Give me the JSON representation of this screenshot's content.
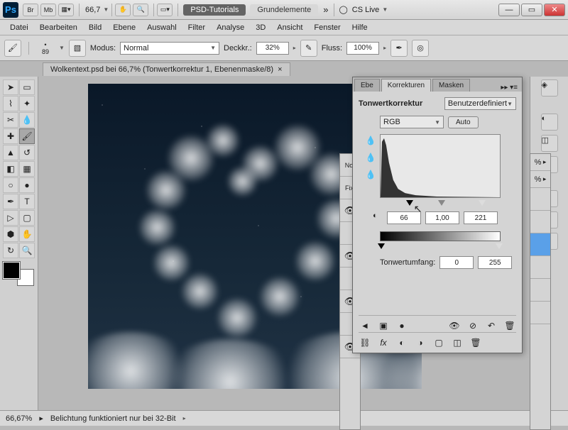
{
  "titlebar": {
    "zoom": "66,7",
    "tabs": [
      "PSD-Tutorials",
      "Grundelemente"
    ],
    "cslive": "CS Live"
  },
  "appicons": {
    "br": "Br",
    "mb": "Mb"
  },
  "menu": [
    "Datei",
    "Bearbeiten",
    "Bild",
    "Ebene",
    "Auswahl",
    "Filter",
    "Analyse",
    "3D",
    "Ansicht",
    "Fenster",
    "Hilfe"
  ],
  "options": {
    "brushSize": "89",
    "modus_label": "Modus:",
    "modus_value": "Normal",
    "deckk_label": "Deckkr.:",
    "deckk_value": "32%",
    "fluss_label": "Fluss:",
    "fluss_value": "100%"
  },
  "doctab": "Wolkentext.psd bei 66,7% (Tonwertkorrektur 1, Ebenenmaske/8)",
  "panel": {
    "tabs": {
      "ebe": "Ebe",
      "korrekturen": "Korrekturen",
      "masken": "Masken"
    },
    "title": "Tonwertkorrektur",
    "preset": "Benutzerdefiniert",
    "channel": "RGB",
    "auto": "Auto",
    "levels": {
      "black": "66",
      "gamma": "1,00",
      "white": "221"
    },
    "output_label": "Tonwertumfang:",
    "output": {
      "black": "0",
      "white": "255"
    }
  },
  "rightstrip": {
    "pct": "%"
  },
  "status": {
    "zoom": "66,67%",
    "msg": "Belichtung funktioniert nur bei 32-Bit"
  }
}
